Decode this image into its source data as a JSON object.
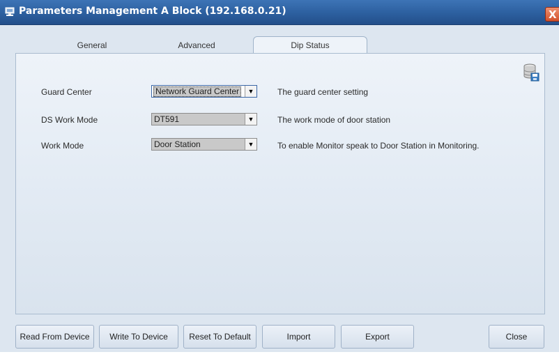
{
  "window": {
    "title": "Parameters Management A Block (192.168.0.21)",
    "close_glyph": "X",
    "accent_color": "#2c5f9f"
  },
  "tabs": [
    {
      "label": "General",
      "active": false
    },
    {
      "label": "Advanced",
      "active": false
    },
    {
      "label": "Dip Status",
      "active": true
    }
  ],
  "icons": {
    "title": "network-computer-icon",
    "save": "save-to-database-icon",
    "dropdown": "chevron-down-icon"
  },
  "settings": [
    {
      "label": "Guard Center",
      "value": "Network Guard Center",
      "description": "The guard center setting"
    },
    {
      "label": "DS Work Mode",
      "value": "DT591",
      "description": "The work mode of door station"
    },
    {
      "label": "Work Mode",
      "value": "Door Station",
      "description": "To enable Monitor speak to Door Station in Monitoring."
    }
  ],
  "dropdown_arrow": "▼",
  "buttons": {
    "read": "Read From Device",
    "write": "Write To Device",
    "reset": "Reset To Default",
    "import": "Import",
    "export": "Export",
    "close": "Close"
  }
}
